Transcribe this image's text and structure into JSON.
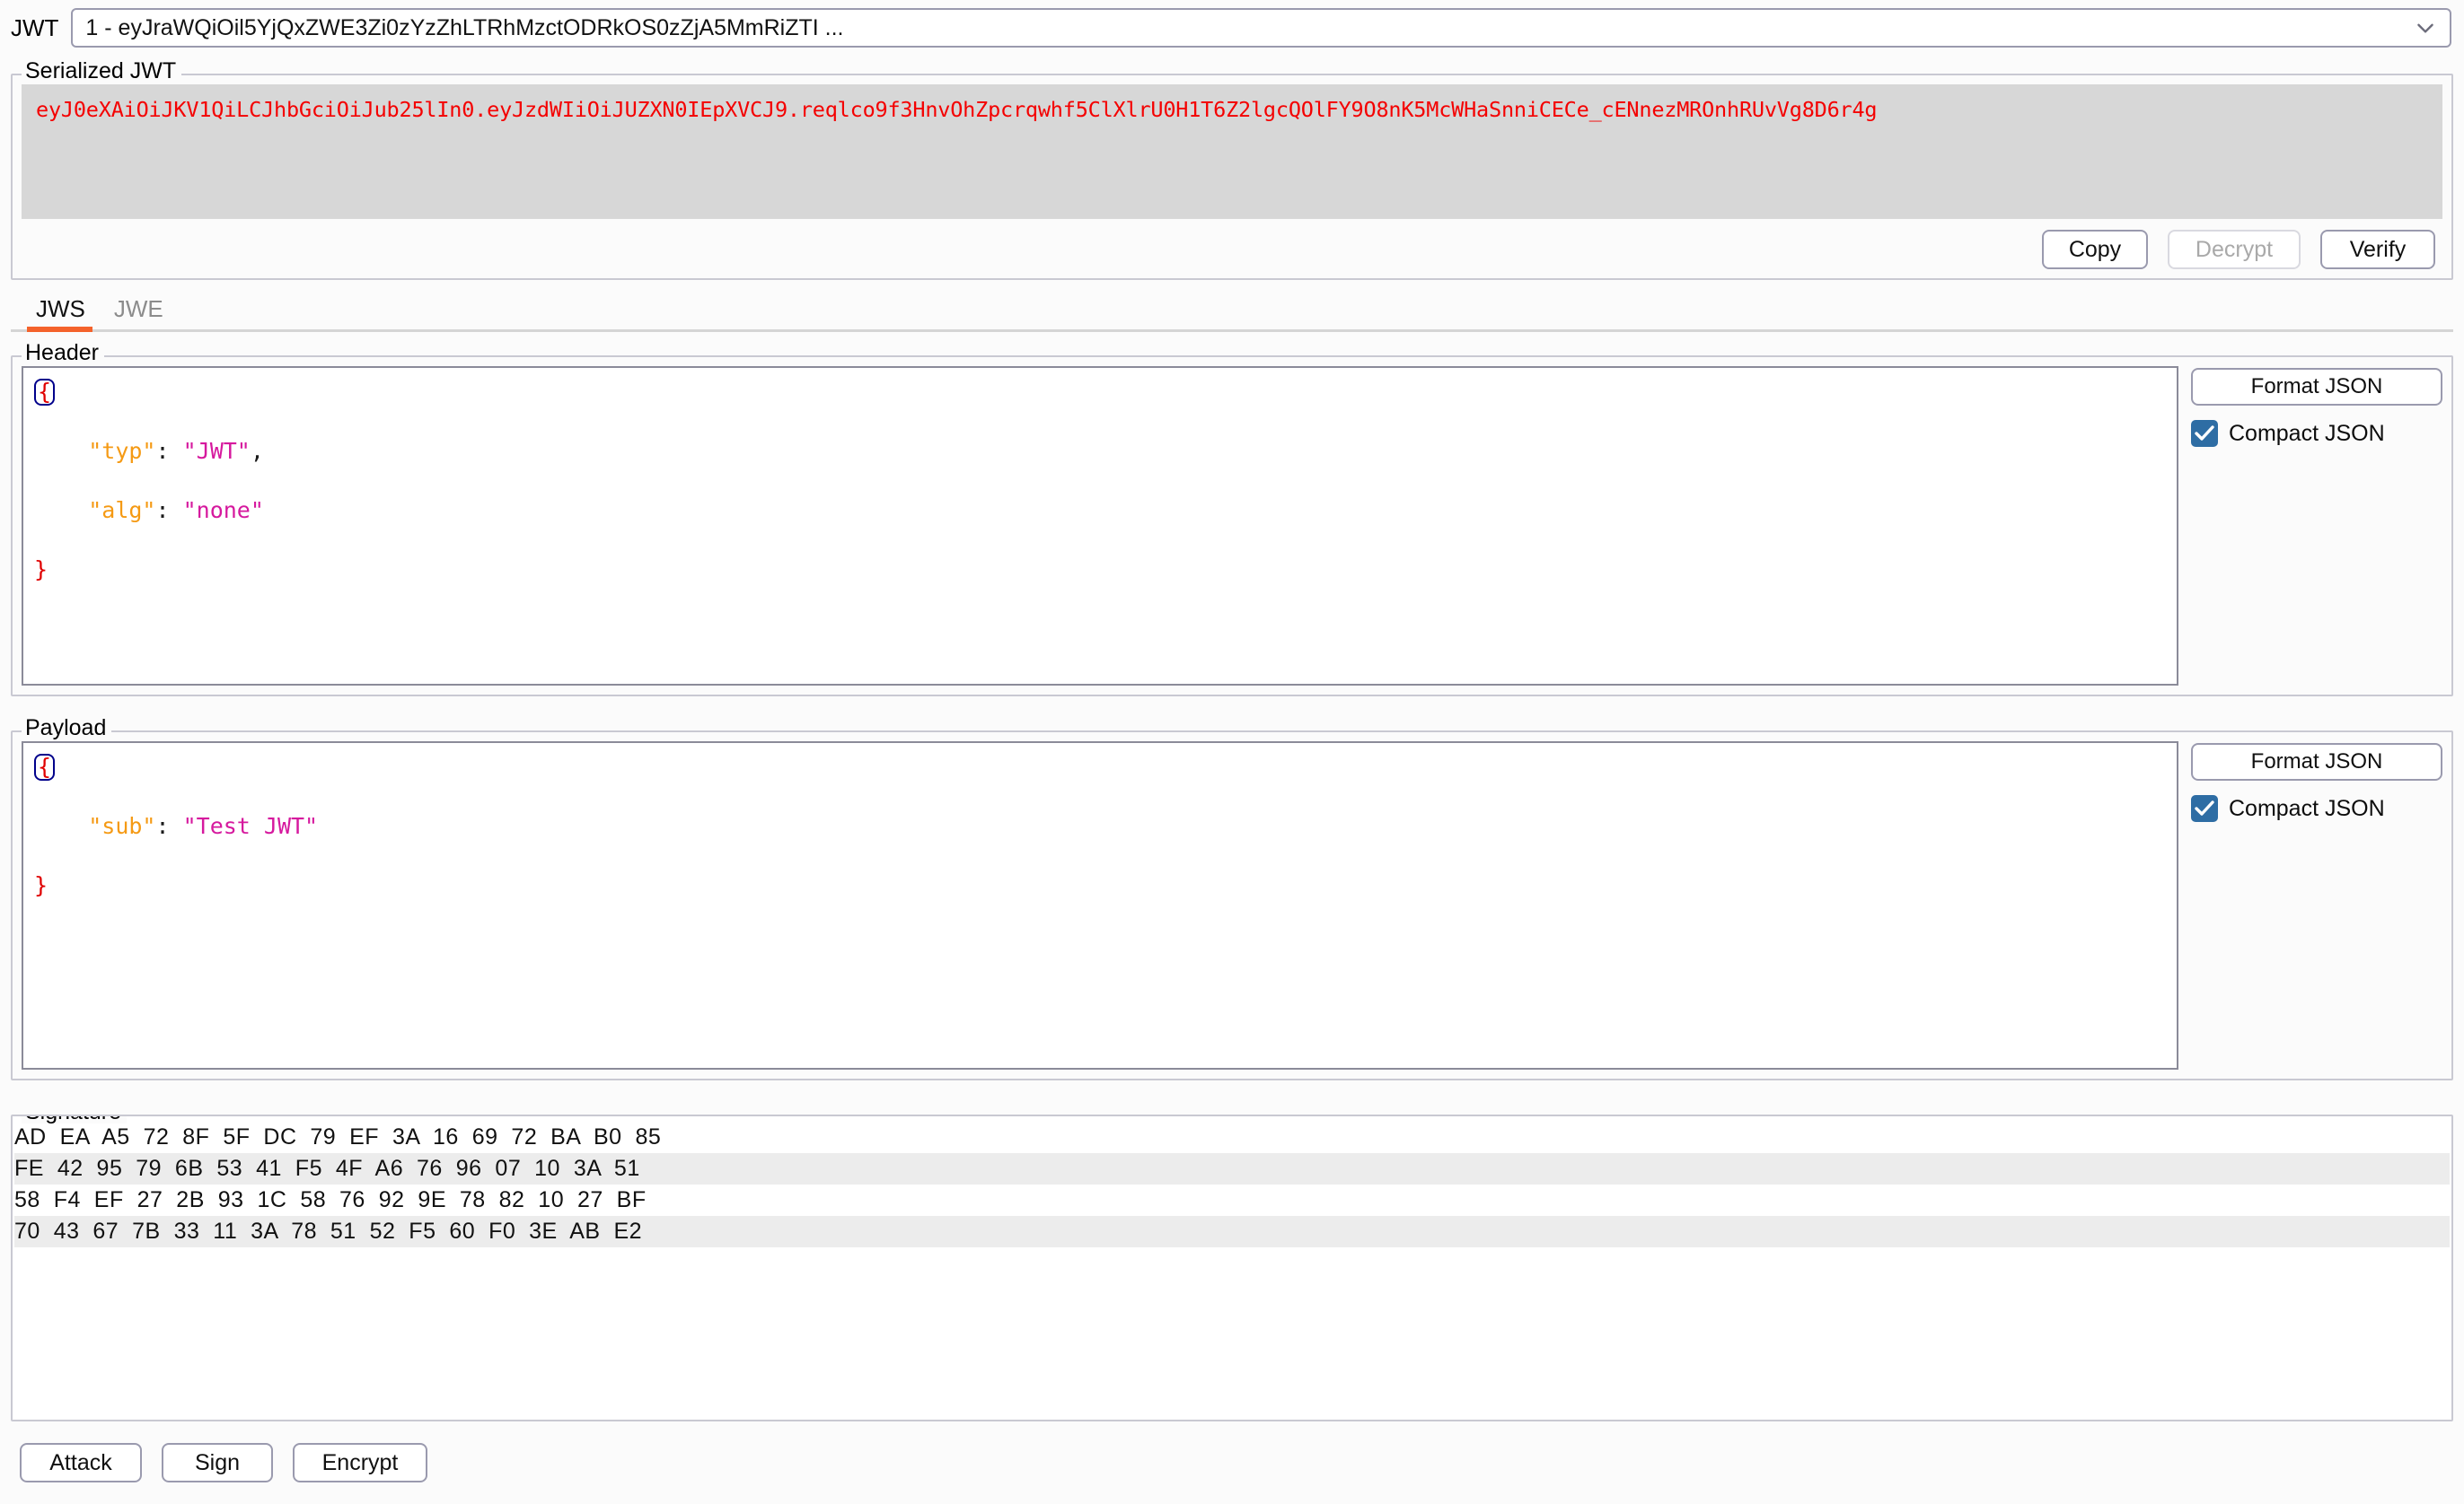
{
  "window": {
    "jwt_label": "JWT",
    "combo_value": "1 - eyJraWQiOil5YjQxZWE3Zi0zYzZhLTRhMzctODRkOS0zZjA5MmRiZTI ...",
    "chevron_icon": "chevron-down-icon"
  },
  "serialized": {
    "legend": "Serialized JWT",
    "token": "eyJ0eXAiOiJKV1QiLCJhbGciOiJub25lIn0.eyJzdWIiOiJUZXN0IEpXVCJ9.reqlco9f3HnvOhZpcrqwhf5ClXlrU0H1T6Z2lgcQOlFY9O8nK5McWHaSnniCECe_cENnezMROnhRUvVg8D6r4g",
    "buttons": {
      "copy": "Copy",
      "decrypt": "Decrypt",
      "verify": "Verify"
    },
    "decrypt_disabled": true
  },
  "tabs": [
    {
      "label": "JWS",
      "active": true
    },
    {
      "label": "JWE",
      "active": false
    }
  ],
  "header_section": {
    "legend": "Header",
    "lines": [
      {
        "brace_open": "{"
      },
      {
        "indent": "    ",
        "key": "\"typ\"",
        "colon": ": ",
        "value": "\"JWT\"",
        "trail": ","
      },
      {
        "indent": "    ",
        "key": "\"alg\"",
        "colon": ": ",
        "value": "\"none\"",
        "trail": ""
      },
      {
        "brace_close": "}"
      }
    ],
    "format_button": "Format JSON",
    "compact_label": "Compact JSON",
    "compact_checked": true
  },
  "payload_section": {
    "legend": "Payload",
    "lines": [
      {
        "brace_open": "{"
      },
      {
        "indent": "    ",
        "key": "\"sub\"",
        "colon": ": ",
        "value": "\"Test JWT\"",
        "trail": ""
      },
      {
        "brace_close": "}"
      }
    ],
    "format_button": "Format JSON",
    "compact_label": "Compact JSON",
    "compact_checked": true
  },
  "signature_section": {
    "legend": "Signature",
    "hex_rows": [
      "AD  EA  A5  72  8F  5F  DC  79  EF  3A  16  69  72  BA  B0  85",
      "FE  42  95  79  6B  53  41  F5  4F  A6  76  96  07  10  3A  51",
      "58  F4  EF  27  2B  93  1C  58  76  92  9E  78  82  10  27  BF",
      "70  43  67  7B  33  11  3A  78  51  52  F5  60  F0  3E  AB  E2"
    ]
  },
  "footer": {
    "attack": "Attack",
    "sign": "Sign",
    "encrypt": "Encrypt"
  },
  "colors": {
    "accent_tab": "#f4622b",
    "token_text": "#f40000",
    "json_key": "#f59a14",
    "json_string": "#d6199e",
    "json_brace": "#e00000",
    "checkbox": "#2e6da4"
  }
}
